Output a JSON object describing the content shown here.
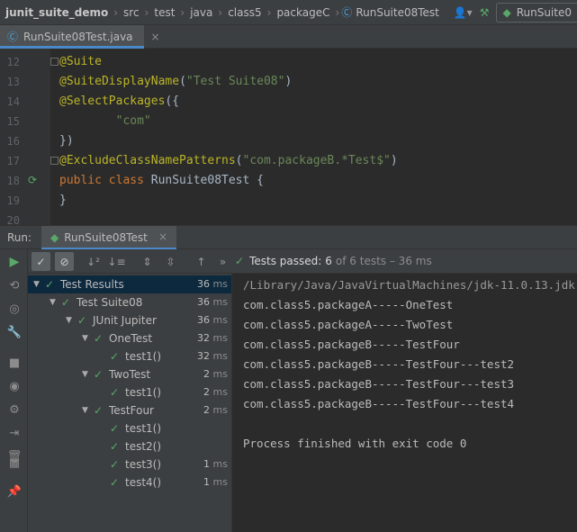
{
  "breadcrumb": [
    "junit_suite_demo",
    "src",
    "test",
    "java",
    "class5",
    "packageC",
    "RunSuite08Test"
  ],
  "run_config_label": "RunSuite0",
  "file_tab": "RunSuite08Test.java",
  "editor_lines": [
    {
      "n": "12",
      "segs": [
        {
          "t": "@Suite",
          "c": "ann"
        }
      ]
    },
    {
      "n": "13",
      "segs": [
        {
          "t": "@SuiteDisplayName",
          "c": "ann"
        },
        {
          "t": "(",
          "c": "plain"
        },
        {
          "t": "\"Test Suite08\"",
          "c": "str"
        },
        {
          "t": ")",
          "c": "plain"
        }
      ]
    },
    {
      "n": "14",
      "segs": [
        {
          "t": "@SelectPackages",
          "c": "ann"
        },
        {
          "t": "({",
          "c": "plain"
        }
      ]
    },
    {
      "n": "15",
      "segs": [
        {
          "t": "        ",
          "c": "plain"
        },
        {
          "t": "\"com\"",
          "c": "str"
        }
      ]
    },
    {
      "n": "16",
      "segs": [
        {
          "t": "})",
          "c": "plain"
        }
      ]
    },
    {
      "n": "17",
      "segs": [
        {
          "t": "@ExcludeClassNamePatterns",
          "c": "ann"
        },
        {
          "t": "(",
          "c": "plain"
        },
        {
          "t": "\"com.packageB.*Test$\"",
          "c": "str"
        },
        {
          "t": ")",
          "c": "plain"
        }
      ]
    },
    {
      "n": "18",
      "segs": [
        {
          "t": "public class ",
          "c": "kw"
        },
        {
          "t": "RunSuite08Test {",
          "c": "plain"
        }
      ]
    },
    {
      "n": "19",
      "segs": [
        {
          "t": "}",
          "c": "plain"
        }
      ]
    },
    {
      "n": "20",
      "segs": []
    }
  ],
  "run_panel": {
    "label": "Run:",
    "tab": "RunSuite08Test"
  },
  "status": {
    "prefix": "Tests passed:",
    "count": "6",
    "suffix": "of 6 tests – 36 ms"
  },
  "tree": [
    {
      "name": "Test Results",
      "time": "36",
      "unit": "ms",
      "depth": 0,
      "arrow": true,
      "sel": true
    },
    {
      "name": "Test Suite08",
      "time": "36",
      "unit": "ms",
      "depth": 1,
      "arrow": true,
      "sel": false
    },
    {
      "name": "JUnit Jupiter",
      "time": "36",
      "unit": "ms",
      "depth": 2,
      "arrow": true,
      "sel": false
    },
    {
      "name": "OneTest",
      "time": "32",
      "unit": "ms",
      "depth": 3,
      "arrow": true,
      "sel": false
    },
    {
      "name": "test1()",
      "time": "32",
      "unit": "ms",
      "depth": 4,
      "arrow": false,
      "sel": false
    },
    {
      "name": "TwoTest",
      "time": "2",
      "unit": "ms",
      "depth": 3,
      "arrow": true,
      "sel": false
    },
    {
      "name": "test1()",
      "time": "2",
      "unit": "ms",
      "depth": 4,
      "arrow": false,
      "sel": false
    },
    {
      "name": "TestFour",
      "time": "2",
      "unit": "ms",
      "depth": 3,
      "arrow": true,
      "sel": false
    },
    {
      "name": "test1()",
      "time": "",
      "unit": "",
      "depth": 4,
      "arrow": false,
      "sel": false
    },
    {
      "name": "test2()",
      "time": "",
      "unit": "",
      "depth": 4,
      "arrow": false,
      "sel": false
    },
    {
      "name": "test3()",
      "time": "1",
      "unit": "ms",
      "depth": 4,
      "arrow": false,
      "sel": false
    },
    {
      "name": "test4()",
      "time": "1",
      "unit": "ms",
      "depth": 4,
      "arrow": false,
      "sel": false
    }
  ],
  "console": [
    "/Library/Java/JavaVirtualMachines/jdk-11.0.13.jdk",
    "com.class5.packageA-----OneTest",
    "com.class5.packageA-----TwoTest",
    "com.class5.packageB-----TestFour",
    "com.class5.packageB-----TestFour---test2",
    "com.class5.packageB-----TestFour---test3",
    "com.class5.packageB-----TestFour---test4",
    "",
    "Process finished with exit code 0"
  ],
  "colors": {
    "accent": "#4a88c7",
    "pass_green": "#59a869",
    "annotation": "#bbb529",
    "string": "#6a8759",
    "keyword": "#cc7832"
  }
}
